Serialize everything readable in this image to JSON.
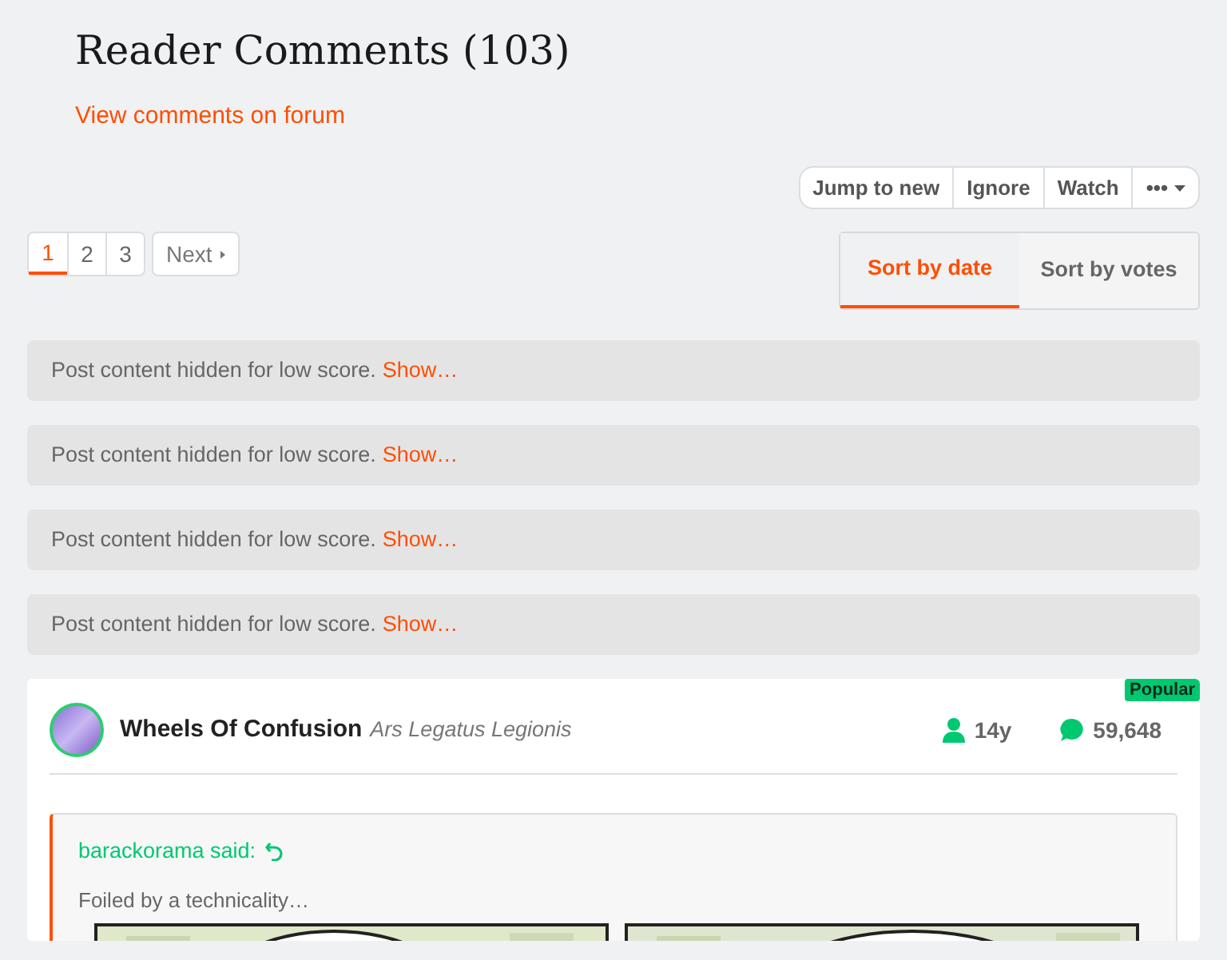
{
  "header": {
    "title": "Reader Comments (103)",
    "forum_link": "View comments on forum"
  },
  "actions": [
    "Jump to new",
    "Ignore",
    "Watch",
    "•••"
  ],
  "pagination": {
    "pages": [
      {
        "label": "1",
        "selected": true
      },
      {
        "label": "2",
        "selected": false
      },
      {
        "label": "3",
        "selected": false
      }
    ],
    "next": "Next"
  },
  "sort_tabs": [
    {
      "label": "Sort by date",
      "selected": true
    },
    {
      "label": "Sort by votes",
      "selected": false
    }
  ],
  "hidden_posts": [
    {
      "text": "Post content hidden for low score.",
      "link": "Show…"
    },
    {
      "text": "Post content hidden for low score.",
      "link": "Show…"
    },
    {
      "text": "Post content hidden for low score.",
      "link": "Show…"
    },
    {
      "text": "Post content hidden for low score.",
      "link": "Show…"
    }
  ],
  "post": {
    "badge": "Popular",
    "author": "Wheels Of Confusion",
    "rank": "Ars Legatus Legionis",
    "tenure": "14y",
    "posts": "59,648",
    "quote": {
      "attribution": "barackorama said:",
      "text": "Foiled by a technicality…"
    }
  }
}
